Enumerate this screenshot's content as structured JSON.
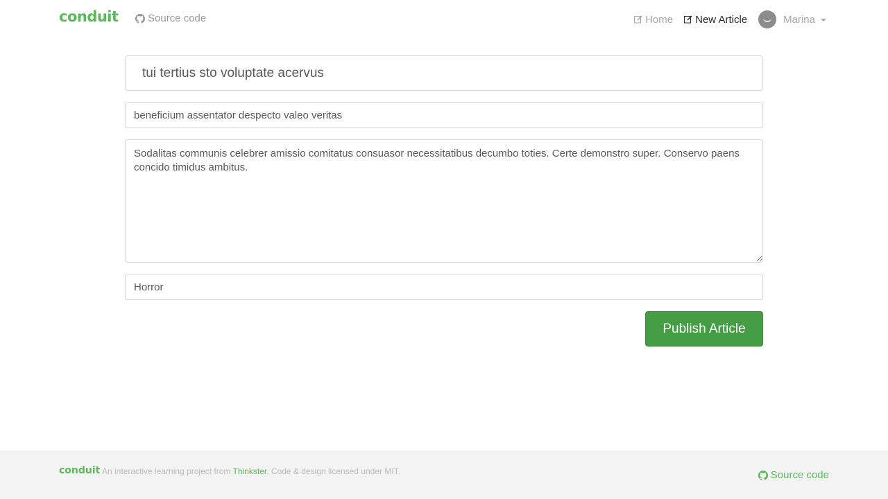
{
  "nav": {
    "brand": "conduit",
    "source_label": "Source code",
    "source_icon": "github-icon",
    "home_label": "Home",
    "home_icon": "edit-icon",
    "new_article_label": "New Article",
    "new_article_icon": "compose-icon",
    "user_name": "Marina"
  },
  "editor": {
    "title_value": "tui tertius sto voluptate acervus",
    "description_value": "beneficium assentator despecto valeo veritas",
    "body_value": "Sodalitas communis celebrer amissio comitatus consuasor necessitatibus decumbo toties. Certe demonstro super. Conservo paens concido timidus ambitus.",
    "tags_value": "Horror",
    "publish_label": "Publish Article"
  },
  "footer": {
    "brand": "conduit",
    "text_before": "An interactive learning project from ",
    "link_label": "Thinkster",
    "text_after": ". Code & design licensed under MIT.",
    "source_label": "Source code"
  },
  "colors": {
    "brand": "#5cb85c",
    "button": "#449d44",
    "footer_bg": "#f3f3f3"
  }
}
